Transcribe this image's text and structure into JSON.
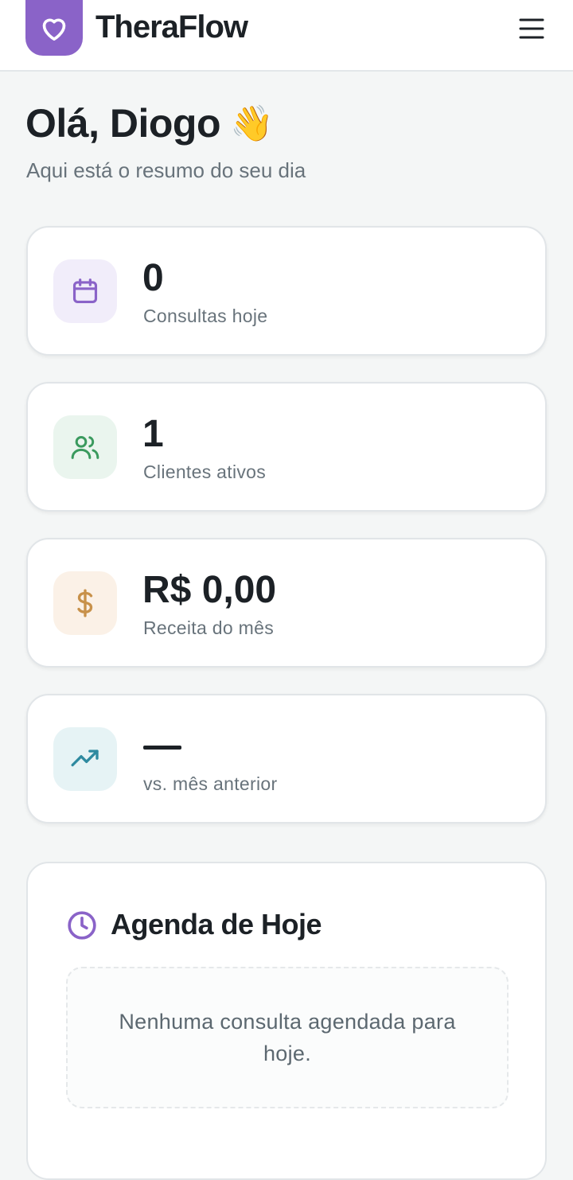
{
  "header": {
    "app_name": "TheraFlow",
    "logo_icon": "heart-icon",
    "menu_icon": "menu-icon"
  },
  "greeting": {
    "title": "Olá, Diogo",
    "emoji": "👋",
    "subtitle": "Aqui está o resumo do seu dia"
  },
  "stats": [
    {
      "icon": "calendar-icon",
      "value": "0",
      "label": "Consultas hoje",
      "color": "#8a63c8",
      "bg": "#f1edfa"
    },
    {
      "icon": "users-icon",
      "value": "1",
      "label": "Clientes ativos",
      "color": "#3a9a5e",
      "bg": "#eaf5ee"
    },
    {
      "icon": "dollar-icon",
      "value": "R$ 0,00",
      "label": "Receita do mês",
      "color": "#c8914a",
      "bg": "#fbf1e7"
    },
    {
      "icon": "trending-up-icon",
      "value": "—",
      "label": "vs. mês anterior",
      "color": "#2f8aa0",
      "bg": "#e6f3f5"
    }
  ],
  "agenda": {
    "title": "Agenda de Hoje",
    "icon": "clock-icon",
    "empty_message": "Nenhuma consulta agendada para hoje."
  },
  "colors": {
    "brand": "#8a63c8",
    "background": "#f4f6f6",
    "text": "#1c2126",
    "muted": "#68737b"
  }
}
